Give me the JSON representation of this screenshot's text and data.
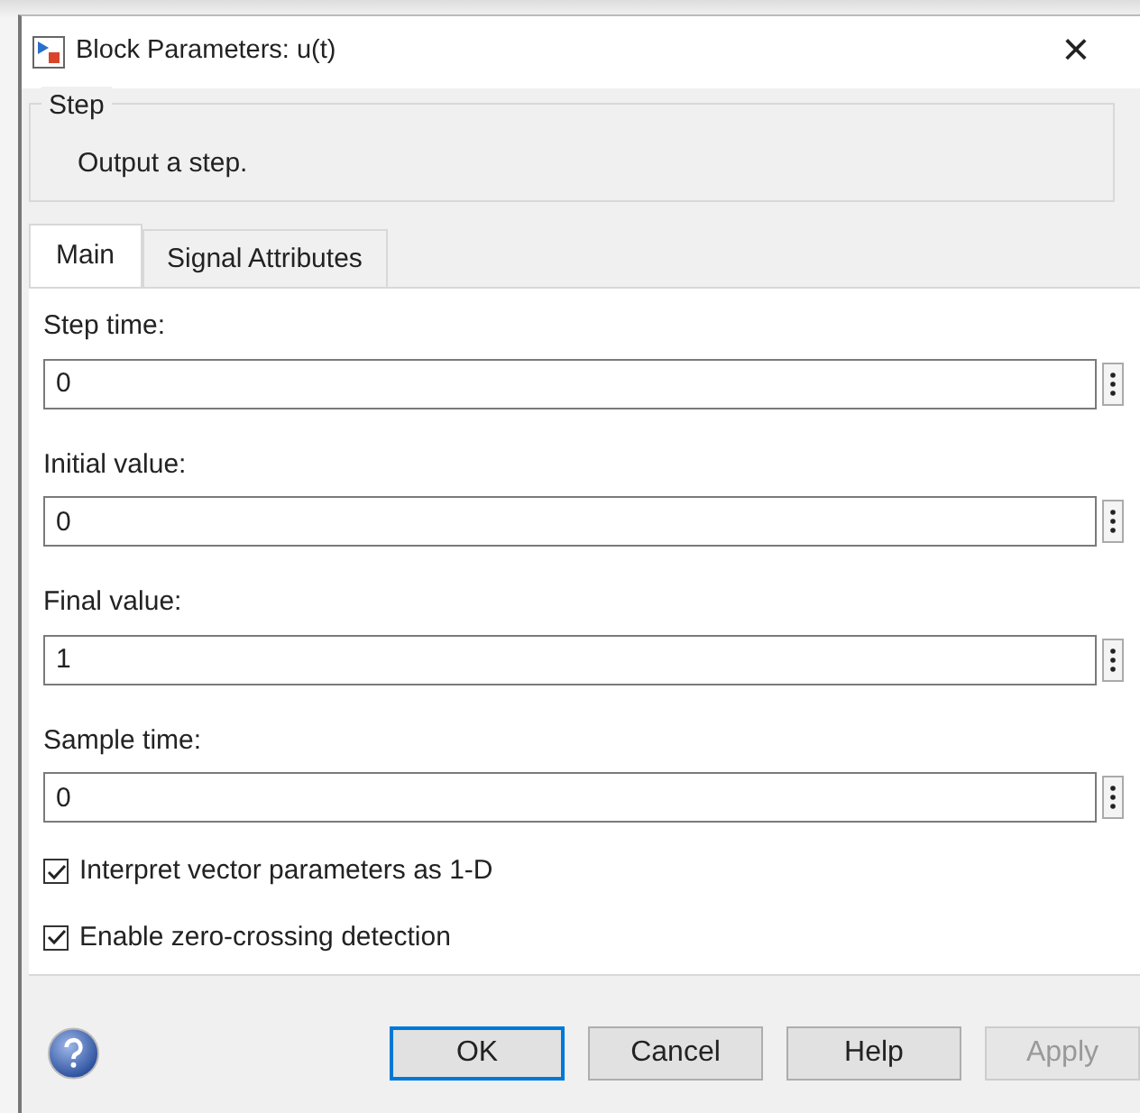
{
  "window": {
    "title": "Block Parameters: u(t)",
    "close": "×"
  },
  "group": {
    "title": "Step",
    "description": "Output a step."
  },
  "tabs": [
    {
      "label": "Main",
      "selected": true
    },
    {
      "label": "Signal Attributes",
      "selected": false
    }
  ],
  "parameters": [
    {
      "label": "Step time:",
      "value": "0"
    },
    {
      "label": "Initial value:",
      "value": "0"
    },
    {
      "label": "Final value:",
      "value": "1"
    },
    {
      "label": "Sample time:",
      "value": "0"
    }
  ],
  "options": [
    {
      "label": "Interpret vector parameters as 1-D",
      "checked": true
    },
    {
      "label": "Enable zero-crossing detection",
      "checked": true
    }
  ],
  "buttons": [
    {
      "label": "OK",
      "default": true,
      "disabled": false
    },
    {
      "label": "Cancel",
      "default": false,
      "disabled": false
    },
    {
      "label": "Help",
      "default": false,
      "disabled": false
    },
    {
      "label": "Apply",
      "default": false,
      "disabled": true
    }
  ]
}
